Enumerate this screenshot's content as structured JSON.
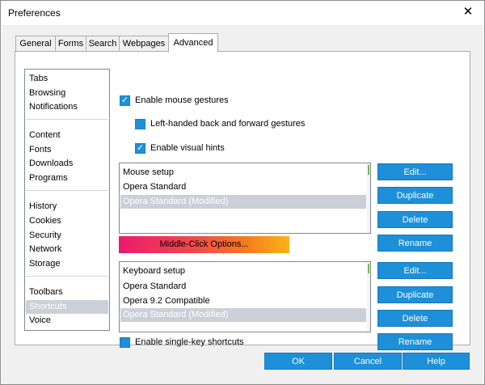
{
  "window": {
    "title": "Preferences",
    "close_glyph": "✕"
  },
  "tabs": [
    {
      "label": "General",
      "active": false
    },
    {
      "label": "Forms",
      "active": false
    },
    {
      "label": "Search",
      "active": false
    },
    {
      "label": "Webpages",
      "active": false
    },
    {
      "label": "Advanced",
      "active": true
    }
  ],
  "sidebar": {
    "items": [
      {
        "label": "Tabs",
        "selected": false
      },
      {
        "label": "Browsing",
        "selected": false
      },
      {
        "label": "Notifications",
        "selected": false
      },
      {
        "label": "Content",
        "selected": false
      },
      {
        "label": "Fonts",
        "selected": false
      },
      {
        "label": "Downloads",
        "selected": false
      },
      {
        "label": "Programs",
        "selected": false
      },
      {
        "label": "History",
        "selected": false
      },
      {
        "label": "Cookies",
        "selected": false
      },
      {
        "label": "Security",
        "selected": false
      },
      {
        "label": "Network",
        "selected": false
      },
      {
        "label": "Storage",
        "selected": false
      },
      {
        "label": "Toolbars",
        "selected": false
      },
      {
        "label": "Shortcuts",
        "selected": true
      },
      {
        "label": "Voice",
        "selected": false
      }
    ]
  },
  "options": {
    "mouse_gestures": {
      "label": "Enable mouse gestures",
      "checked": true
    },
    "left_handed": {
      "label": "Left-handed back and forward gestures",
      "checked": false
    },
    "visual_hints": {
      "label": "Enable visual hints",
      "checked": true
    },
    "single_key": {
      "label": "Enable single-key shortcuts",
      "checked": false
    }
  },
  "mouse_setup": {
    "items": [
      {
        "label": "Mouse setup",
        "selected": false
      },
      {
        "label": "Opera Standard",
        "selected": false
      },
      {
        "label": "Opera Standard (Modified)",
        "selected": true
      }
    ]
  },
  "keyboard_setup": {
    "items": [
      {
        "label": "Keyboard setup",
        "selected": false
      },
      {
        "label": "Opera Standard",
        "selected": false
      },
      {
        "label": "Opera 9.2 Compatible",
        "selected": false
      },
      {
        "label": "Opera Standard (Modified)",
        "selected": true
      }
    ]
  },
  "mouse_buttons": {
    "edit": "Edit...",
    "duplicate": "Duplicate",
    "delete": "Delete",
    "rename": "Rename"
  },
  "keyboard_buttons": {
    "edit": "Edit...",
    "duplicate": "Duplicate",
    "delete": "Delete",
    "rename": "Rename"
  },
  "middle_click": {
    "label": "Middle-Click Options..."
  },
  "dialog_buttons": {
    "ok": "OK",
    "cancel": "Cancel",
    "help": "Help"
  },
  "colors": {
    "accent": "#1e8fd9",
    "selection": "#cbd0d8",
    "gradient_start": "#ec1a6c",
    "gradient_end": "#fbb316"
  },
  "check_glyph": "✓"
}
